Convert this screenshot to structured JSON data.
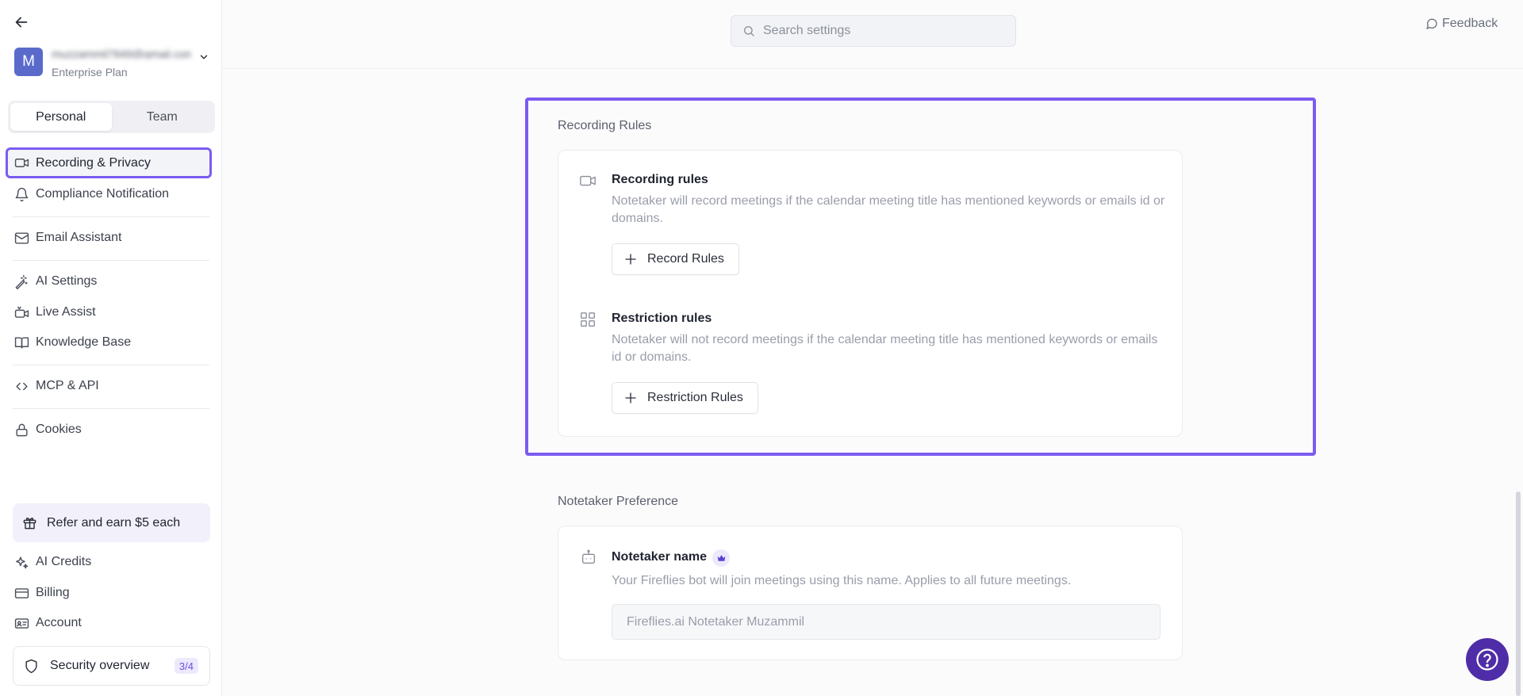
{
  "sidebar": {
    "account": {
      "avatar_initial": "M",
      "email": "muzzammil7849@gmail.com",
      "plan": "Enterprise Plan"
    },
    "tabs": {
      "personal": "Personal",
      "team": "Team"
    },
    "items": {
      "recording_privacy": "Recording & Privacy",
      "compliance": "Compliance Notification",
      "email_assistant": "Email Assistant",
      "ai_settings": "AI Settings",
      "live_assist": "Live Assist",
      "knowledge_base": "Knowledge Base",
      "mcp_api": "MCP & API",
      "cookies": "Cookies"
    },
    "refer": "Refer and earn $5 each",
    "bottom_items": {
      "ai_credits": "AI Credits",
      "billing": "Billing",
      "account": "Account"
    },
    "security": {
      "label": "Security overview",
      "badge": "3/4"
    }
  },
  "header": {
    "search_placeholder": "Search settings",
    "feedback": "Feedback"
  },
  "recording_rules": {
    "section_title": "Recording Rules",
    "record": {
      "title": "Recording rules",
      "description": "Notetaker will record meetings if the calendar meeting title has mentioned keywords or emails id or domains.",
      "button": "Record Rules"
    },
    "restriction": {
      "title": "Restriction rules",
      "description": "Notetaker will not record meetings if the calendar meeting title has mentioned keywords or emails id or domains.",
      "button": "Restriction Rules"
    }
  },
  "notetaker_preference": {
    "section_title": "Notetaker Preference",
    "name_title": "Notetaker name",
    "name_description": "Your Fireflies bot will join meetings using this name. Applies to all future meetings.",
    "name_placeholder": "Fireflies.ai Notetaker Muzammil"
  },
  "colors": {
    "accent": "#7b5cf0",
    "help_button": "#4f2da8",
    "avatar": "#5a6acb"
  }
}
